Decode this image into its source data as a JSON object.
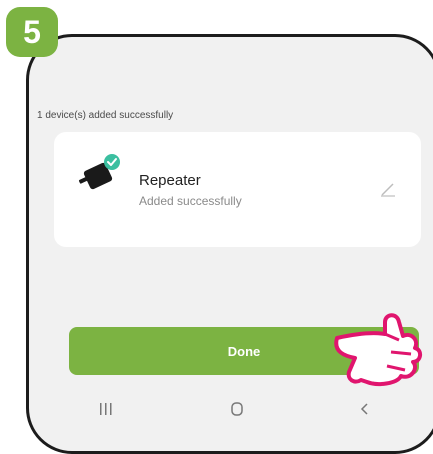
{
  "step": {
    "number": "5"
  },
  "header": {
    "text": "1 device(s) added successfully"
  },
  "device": {
    "name": "Repeater",
    "status": "Added successfully"
  },
  "actions": {
    "done_label": "Done"
  },
  "nav": {
    "items": [
      "recents-icon",
      "home-icon",
      "back-icon"
    ]
  },
  "colors": {
    "accent": "#7cb342",
    "background": "#f1f1f1",
    "card": "#ffffff",
    "hand": "#e0156e"
  }
}
